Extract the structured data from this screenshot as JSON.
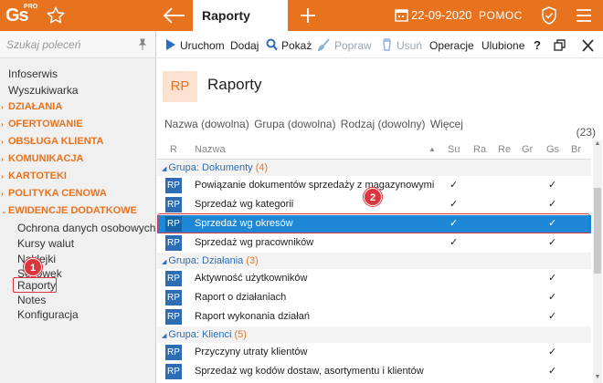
{
  "topbar": {
    "logo_text": "Gs",
    "logo_pro": "PRO",
    "tab_title": "Raporty",
    "date": "22-09-2020",
    "help_label": "POMOC",
    "accent": "#e8731f"
  },
  "sidebar": {
    "search_placeholder": "Szukaj poleceń",
    "items": [
      {
        "label": "Infoserwis"
      },
      {
        "label": "Wyszukiwarka"
      }
    ],
    "categories": [
      {
        "label": "DZIAŁANIA"
      },
      {
        "label": "OFERTOWANIE"
      },
      {
        "label": "OBSŁUGA KLIENTA"
      },
      {
        "label": "KOMUNIKACJA"
      },
      {
        "label": "KARTOTEKI"
      },
      {
        "label": "POLITYKA CENOWA"
      },
      {
        "label": "EWIDENCJE DODATKOWE"
      }
    ],
    "subitems": [
      {
        "label": "Ochrona danych osobowych"
      },
      {
        "label": "Kursy walut"
      },
      {
        "label": "Naklejki"
      },
      {
        "label": "Schowek"
      },
      {
        "label": "Raporty"
      },
      {
        "label": "Notes"
      },
      {
        "label": "Konfiguracja"
      }
    ]
  },
  "toolbar": {
    "run": "Uruchom",
    "add": "Dodaj",
    "show": "Pokaż",
    "fix": "Popraw",
    "delete": "Usuń",
    "operations": "Operacje",
    "favorites": "Ulubione",
    "help": "?"
  },
  "header": {
    "icon_text": "RP",
    "title": "Raporty"
  },
  "filters": {
    "name": "Nazwa (dowolna)",
    "group": "Grupa (dowolna)",
    "kind": "Rodzaj (dowolny)",
    "more": "Więcej",
    "count": "(23)"
  },
  "grid": {
    "columns": [
      "R",
      "Nazwa",
      "Su",
      "Ra",
      "Re",
      "Gr",
      "Gs",
      "Br"
    ],
    "check": "✓",
    "row_icon": "RP",
    "groups": [
      {
        "prefix": "Grupa:",
        "name": "Dokumenty",
        "count": "(4)",
        "rows": [
          {
            "name": "Powiązanie dokumentów sprzedaży z magazynowymi",
            "su": true,
            "gs": true
          },
          {
            "name": "Sprzedaż wg kategorii",
            "su": true,
            "gs": true
          },
          {
            "name": "Sprzedaż wg okresów",
            "su": true,
            "gs": true,
            "selected": true
          },
          {
            "name": "Sprzedaż wg pracowników",
            "su": true,
            "gs": true
          }
        ]
      },
      {
        "prefix": "Grupa:",
        "name": "Działania",
        "count": "(3)",
        "rows": [
          {
            "name": "Aktywność użytkowników",
            "su": false,
            "gs": true
          },
          {
            "name": "Raport o działaniach",
            "su": false,
            "gs": true
          },
          {
            "name": "Raport wykonania działań",
            "su": false,
            "gs": true
          }
        ]
      },
      {
        "prefix": "Grupa:",
        "name": "Klienci",
        "count": "(5)",
        "rows": [
          {
            "name": "Przyczyny utraty klientów",
            "su": false,
            "gs": true
          },
          {
            "name": "Sprzedaż wg kodów dostaw, asortymentu i klientów",
            "su": false,
            "gs": true
          }
        ]
      }
    ]
  },
  "annotations": {
    "badge1": "1",
    "badge2": "2",
    "highlight_color": "#d9363e"
  }
}
